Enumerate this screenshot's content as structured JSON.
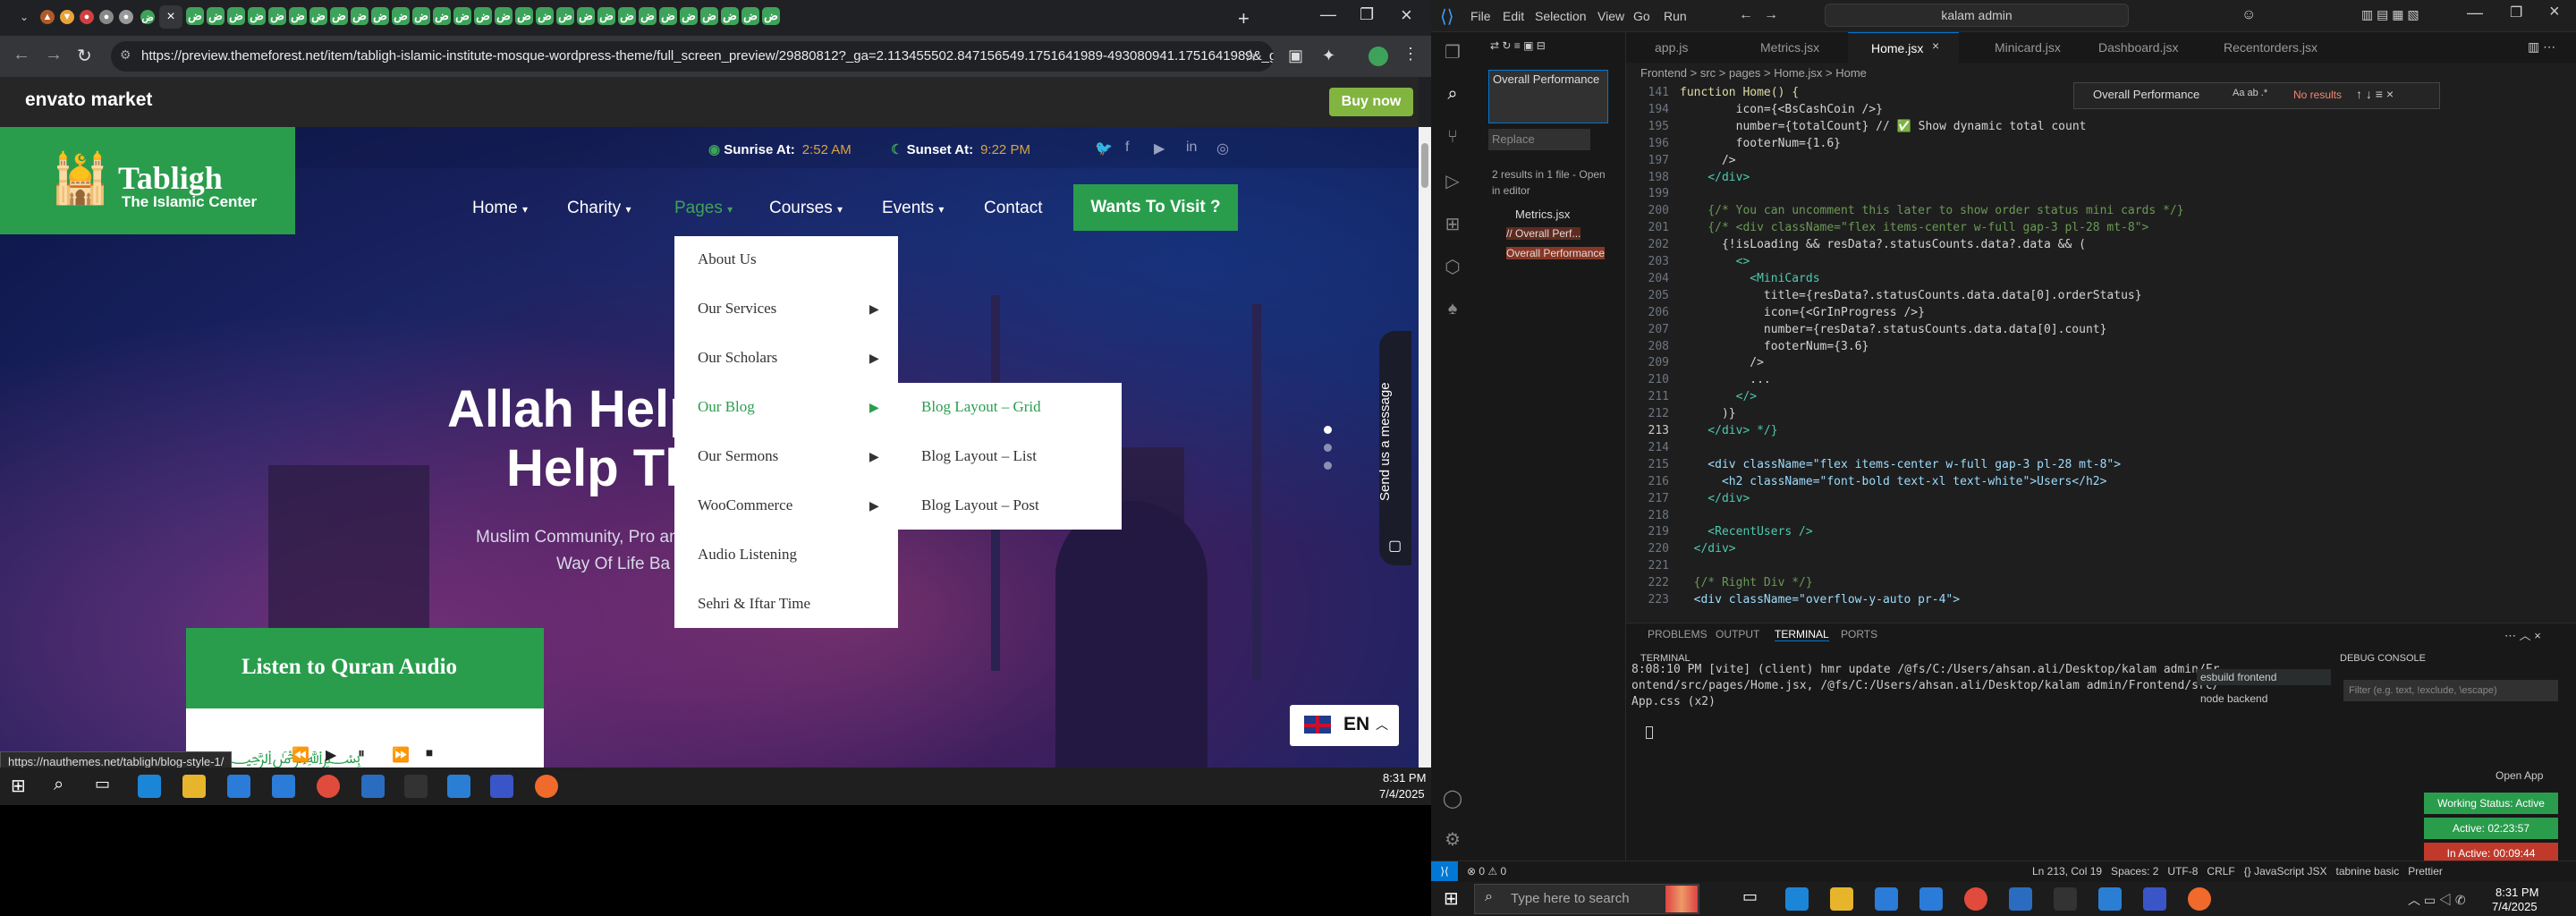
{
  "browser": {
    "url": "https://preview.themeforest.net/item/tabligh-islamic-institute-mosque-wordpress-theme/full_screen_preview/29880812?_ga=2.113455502.847156549.1751641989-493080941.1751641989&_gac=1...",
    "tab_glyph": "ض",
    "envato_logo": "envato market",
    "buy_now": "Buy now",
    "status_url": "https://nauthemes.net/tabligh/blog-style-1/"
  },
  "site": {
    "logo_title": "Tabligh",
    "logo_subtitle": "The Islamic Center",
    "sunrise_label": "Sunrise At:",
    "sunrise_time": "2:52 AM",
    "sunset_label": "Sunset At:",
    "sunset_time": "9:22 PM",
    "nav": [
      "Home",
      "Charity",
      "Pages",
      "Courses",
      "Events",
      "Contact"
    ],
    "visit_button": "Wants To Visit ?",
    "dropdown": [
      "About Us",
      "Our Services",
      "Our Scholars",
      "Our Blog",
      "Our Sermons",
      "WooCommerce",
      "Audio Listening",
      "Sehri & Iftar Time"
    ],
    "submenu": [
      "Blog Layout – Grid",
      "Blog Layout – List",
      "Blog Layout – Post"
    ],
    "hero_line1": "Allah Help",
    "hero_line2": "Help Th",
    "hero_sub1": "Muslim Community, Pro                         amic",
    "hero_sub2": "Way Of Life Ba",
    "listen_quran": "Listen to Quran Audio",
    "chat_label": "Send us a message",
    "lang": "EN"
  },
  "taskbar_left": {
    "time": "8:31 PM",
    "date": "7/4/2025"
  },
  "vscode": {
    "menus": [
      "File",
      "Edit",
      "Selection",
      "View",
      "Go",
      "Run"
    ],
    "search_box": "kalam admin",
    "tabs": [
      "app.js",
      "Metrics.jsx",
      "Home.jsx",
      "Minicard.jsx",
      "Dashboard.jsx",
      "Recentorders.jsx"
    ],
    "breadcrumb": "Frontend > src > pages > Home.jsx > Home",
    "find_query": "Overall Performance",
    "find_result": "No results",
    "sidebar_search": "Overall Performance",
    "sidebar_replace": "Replace",
    "results_summary": "2 results in 1 file - Open in editor",
    "result_file": "Metrics.jsx",
    "result_line1": "// Overall Perf...",
    "result_line2": "Overall Performance",
    "lines": [
      [
        "141",
        "function Home() {"
      ],
      [
        "194",
        "        icon={<BsCashCoin />}"
      ],
      [
        "195",
        "        number={totalCount} // ✅ Show dynamic total count"
      ],
      [
        "196",
        "        footerNum={1.6}"
      ],
      [
        "197",
        "      />"
      ],
      [
        "198",
        "    </div>"
      ],
      [
        "199",
        ""
      ],
      [
        "200",
        "    {/* You can uncomment this later to show order status mini cards */}"
      ],
      [
        "201",
        "    {/* <div className=\"flex items-center w-full gap-3 pl-28 mt-8\">"
      ],
      [
        "202",
        "      {!isLoading && resData?.statusCounts.data?.data && ("
      ],
      [
        "203",
        "        <>"
      ],
      [
        "204",
        "          <MiniCards"
      ],
      [
        "205",
        "            title={resData?.statusCounts.data.data[0].orderStatus}"
      ],
      [
        "206",
        "            icon={<GrInProgress />}"
      ],
      [
        "207",
        "            number={resData?.statusCounts.data.data[0].count}"
      ],
      [
        "208",
        "            footerNum={3.6}"
      ],
      [
        "209",
        "          />"
      ],
      [
        "210",
        "          ..."
      ],
      [
        "211",
        "        </>"
      ],
      [
        "212",
        "      )}"
      ],
      [
        "213",
        "    </div> */}"
      ],
      [
        "214",
        ""
      ],
      [
        "215",
        "    <div className=\"flex items-center w-full gap-3 pl-28 mt-8\">"
      ],
      [
        "216",
        "      <h2 className=\"font-bold text-xl text-white\">Users</h2>"
      ],
      [
        "217",
        "    </div>"
      ],
      [
        "218",
        ""
      ],
      [
        "219",
        "    <RecentUsers />"
      ],
      [
        "220",
        "  </div>"
      ],
      [
        "221",
        ""
      ],
      [
        "222",
        "  {/* Right Div */}"
      ],
      [
        "223",
        "  <div className=\"overflow-y-auto pr-4\">"
      ]
    ],
    "panel_tabs": [
      "PROBLEMS",
      "OUTPUT",
      "TERMINAL",
      "PORTS"
    ],
    "terminal_title": "TERMINAL",
    "debug_title": "DEBUG CONSOLE",
    "terminal_text": "8:08:10 PM [vite] (client) hmr update /@fs/C:/Users/ahsan.ali/Desktop/kalam admin/Fr\nontend/src/pages/Home.jsx, /@fs/C:/Users/ahsan.ali/Desktop/kalam admin/Frontend/src/\nApp.css (x2)",
    "term_sessions": [
      "esbuild frontend",
      "node backend"
    ],
    "debug_filter": "Filter (e.g. text, !exclude, \\escape)",
    "status_left": "⊗ 0 ⚠ 0",
    "status_right": "Ln 213, Col 19   Spaces: 2   UTF-8   CRLF   {} JavaScript JSX   tabnine basic   Prettier",
    "open_app": "Open App",
    "working_status": "Working Status: Active",
    "active_time": "Active: 02:23:57",
    "inactive_time": "In Active: 00:09:44"
  },
  "taskbar_right": {
    "search": "Type here to search",
    "time": "8:31 PM",
    "date": "7/4/2025"
  },
  "colors": {
    "green": "#2a9d4d",
    "envato_green": "#82b440",
    "vscode_blue": "#0078d4"
  }
}
